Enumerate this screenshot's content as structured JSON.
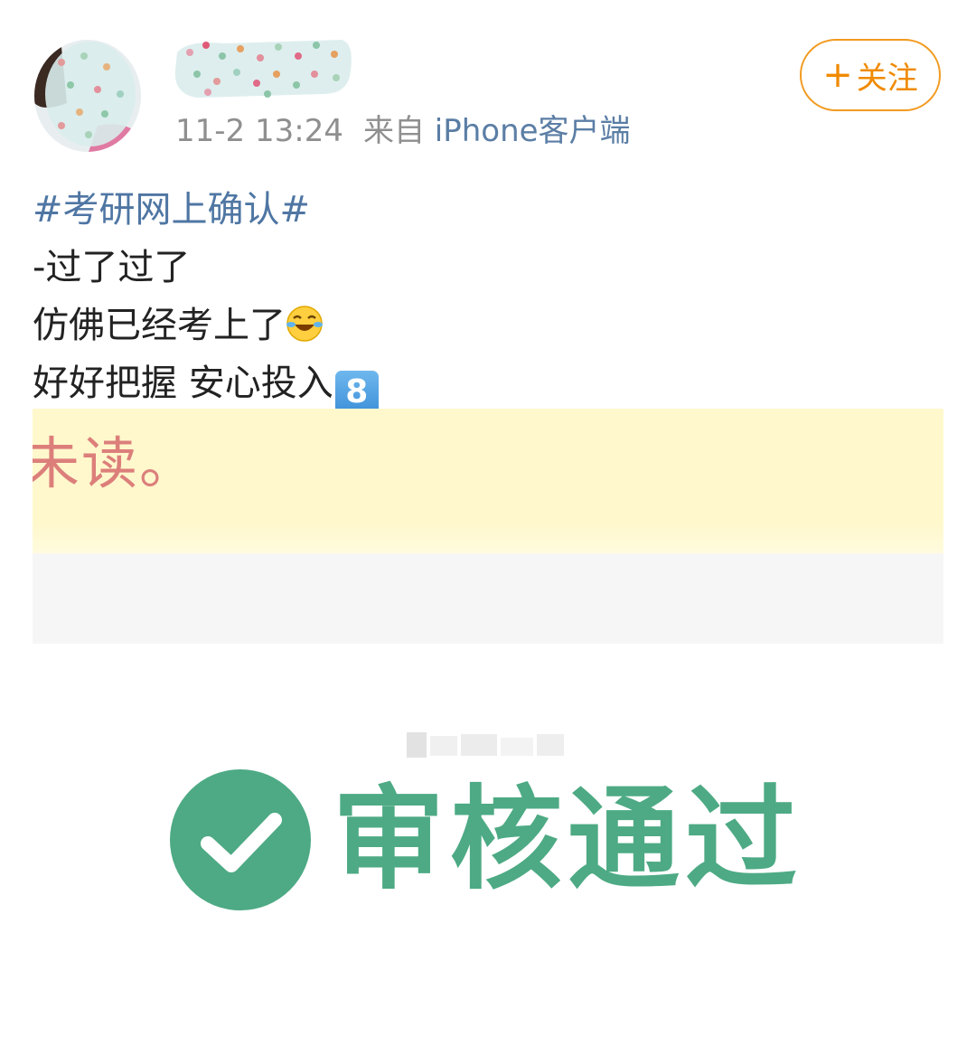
{
  "post": {
    "timestamp": "11-2 13:24",
    "source_prefix": "来自",
    "source_client": "iPhone客户端",
    "follow_label": "关注",
    "follow_icon": "plus-icon",
    "lines": {
      "hashtag": "#考研网上确认#",
      "line1": "-过了过了",
      "line2": "仿佛已经考上了",
      "line3": "好好把握 安心投入"
    },
    "emoji_line2": "laughing-crying-emoji",
    "keycap_line3": "8"
  },
  "embedded_image": {
    "notice_text": "未读。",
    "status_text": "审核通过",
    "status_icon": "check-circle-icon",
    "colors": {
      "status": "#4daa84",
      "notice": "#dc7f7b",
      "notice_bg": "#fff8cc"
    }
  },
  "colors": {
    "accent": "#f08a00",
    "link": "#4f76a3",
    "meta": "#8f8f8f"
  }
}
